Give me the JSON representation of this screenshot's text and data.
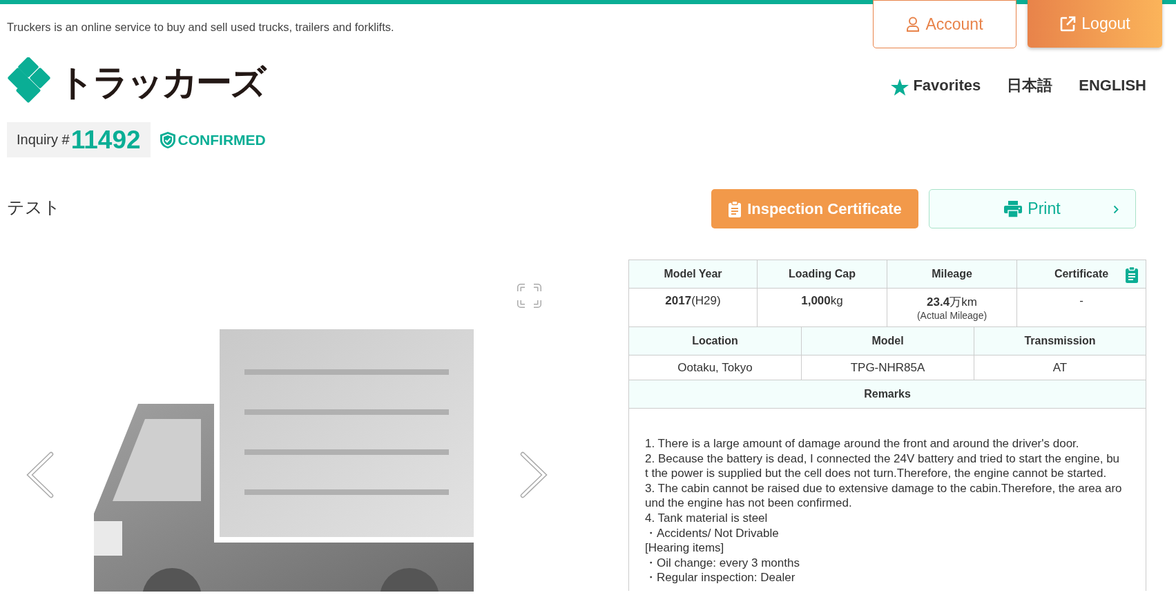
{
  "header": {
    "tagline": "Truckers is an online service to buy and sell used trucks, trailers and forklifts.",
    "user_buttons": [
      {
        "label": "Account",
        "kind": "outline"
      },
      {
        "label": "Logout",
        "kind": "gradient"
      }
    ],
    "logo": "トラッカーズ",
    "nav": [
      {
        "label": "Favorites",
        "kind": "star"
      },
      {
        "label": "日本語",
        "kind": "plain"
      },
      {
        "label": "ENGLISH",
        "kind": "plain"
      }
    ]
  },
  "inquiry": {
    "label": "Inquiry #",
    "number": "11492",
    "status": "CONFIRMED"
  },
  "title": "テスト",
  "actions": [
    {
      "label": "Inspection Certificate",
      "kind": "primary"
    },
    {
      "label": "Print",
      "kind": "secondary"
    }
  ],
  "specs": {
    "row_1": [
      {
        "heading": "Model Year",
        "value": "**2017**(H29)"
      },
      {
        "heading": "Loading Cap",
        "value": "**1,000**kg"
      },
      {
        "heading": "Mileage",
        "value": "**23.4**万km",
        "note": "(Actual Mileage)"
      },
      {
        "heading": "Certificate",
        "value": "-",
        "icon": true
      }
    ],
    "row_2": [
      {
        "heading": "Location",
        "value": "Ootaku, Tokyo"
      },
      {
        "heading": "Model",
        "value": "TPG-NHR85A"
      },
      {
        "heading": "Transmission",
        "value": "AT"
      }
    ],
    "remarks": {
      "heading": "Remarks",
      "lines": [
        "1. There is a large amount of damage around the front and around the driver's door.",
        "2. Because the battery is dead, I connected the 24V battery and tried to start the engine, but the power is supplied but the cell does not turn.Therefore, the engine cannot be started.",
        "3. The cabin cannot be raised due to extensive damage to the cabin.Therefore, the area around the engine has not been confirmed.",
        "4. Tank material is steel",
        "・Accidents/ Not Drivable",
        "[Hearing items]",
        "・Oil change: every 3 months",
        "・Regular inspection: Dealer"
      ]
    }
  }
}
